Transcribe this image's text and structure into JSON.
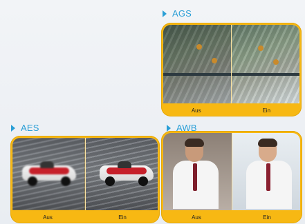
{
  "sections": {
    "ags": {
      "title": "AGS",
      "left_caption": "Aus",
      "right_caption": "Ein"
    },
    "aes": {
      "title": "AES",
      "left_caption": "Aus",
      "right_caption": "Ein"
    },
    "awb": {
      "title": "AWB",
      "left_caption": "Aus",
      "right_caption": "Ein"
    }
  },
  "colors": {
    "accent": "#2a9fd6",
    "caption_bar": "#f7b813"
  },
  "icons": {
    "section_marker": "arrow-icon"
  }
}
